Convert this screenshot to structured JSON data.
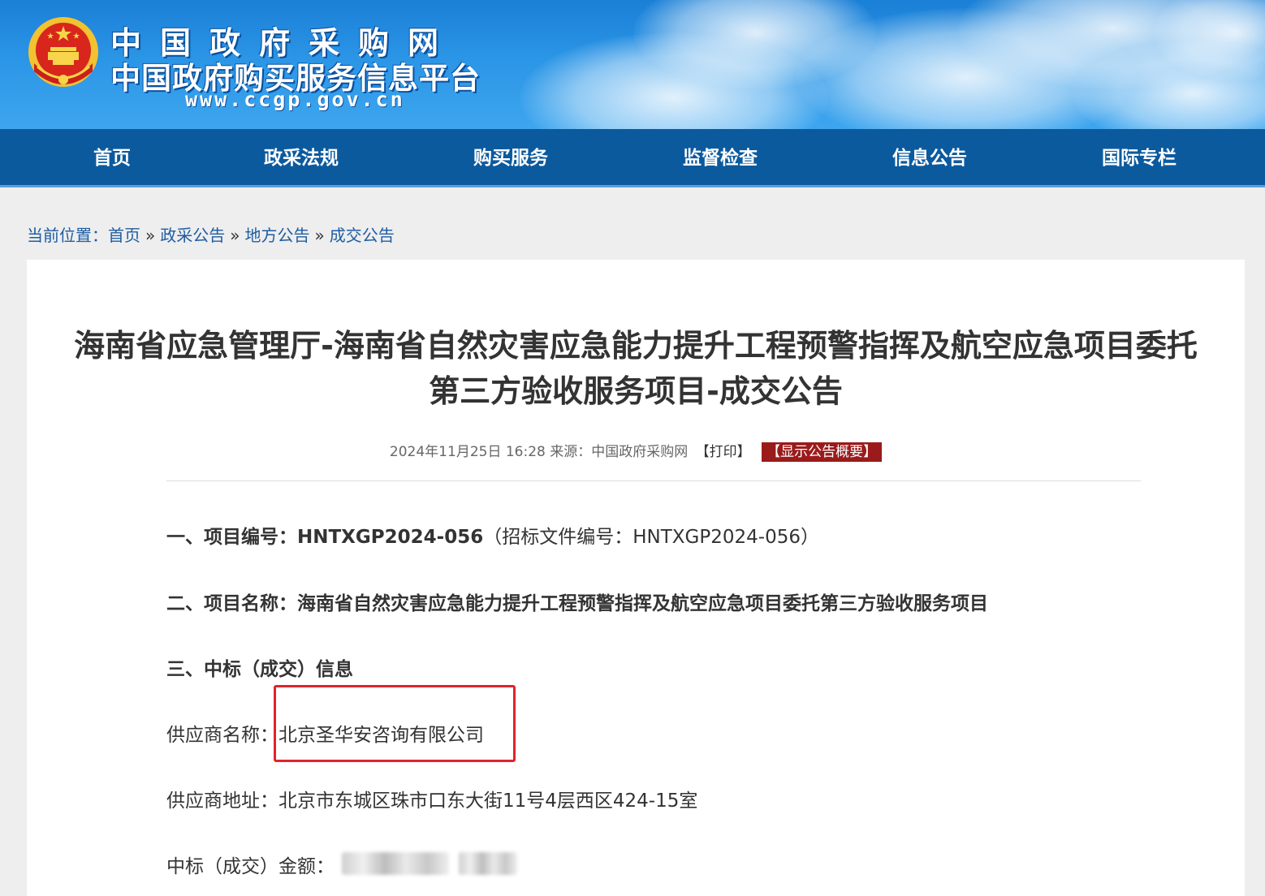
{
  "banner": {
    "site_title": "中国政府采购网",
    "site_subtitle": "中国政府购买服务信息平台",
    "site_url": "www.ccgp.gov.cn"
  },
  "nav": {
    "items": [
      {
        "label": "首页"
      },
      {
        "label": "政采法规"
      },
      {
        "label": "购买服务"
      },
      {
        "label": "监督检查"
      },
      {
        "label": "信息公告"
      },
      {
        "label": "国际专栏"
      }
    ]
  },
  "breadcrumb": {
    "prefix": "当前位置：",
    "items": [
      "首页",
      "政采公告",
      "地方公告",
      "成交公告"
    ],
    "separator": "»"
  },
  "article": {
    "title_line1": "海南省应急管理厅-海南省自然灾害应急能力提升工程预警指挥及航空应急项目委托",
    "title_line2": "第三方验收服务项目-成交公告",
    "date": "2024年11月25日 16:28",
    "source_label": "来源：",
    "source": "中国政府采购网",
    "print_label": "【打印】",
    "summary_label": "【显示公告概要】",
    "sections": {
      "s1_label": "一、项目编号：",
      "s1_value": "HNTXGP2024-056",
      "s1_extra": "（招标文件编号：HNTXGP2024-056）",
      "s2_label": "二、项目名称：",
      "s2_value": "海南省自然灾害应急能力提升工程预警指挥及航空应急项目委托第三方验收服务项目",
      "s3_label": "三、中标（成交）信息",
      "supplier_name_label": "供应商名称：",
      "supplier_name": "北京圣华安咨询有限公司",
      "supplier_addr_label": "供应商地址：",
      "supplier_addr": "北京市东城区珠市口东大街11号4层西区424-15室",
      "amount_label": "中标（成交）金额："
    }
  },
  "colors": {
    "nav_bg": "#0c5a9e",
    "banner_blue": "#2b95e6",
    "highlight_red": "#e0242b",
    "summary_btn": "#9b1b1b",
    "link_blue": "#1f5da3"
  }
}
